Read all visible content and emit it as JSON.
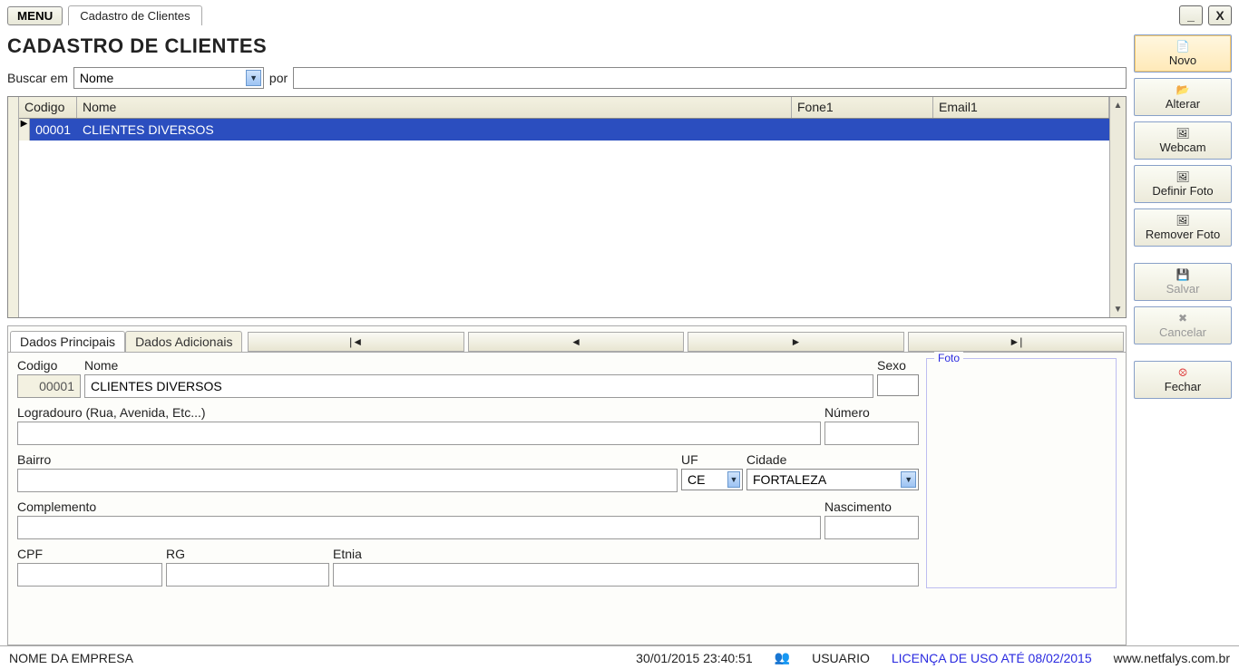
{
  "header": {
    "menu_label": "MENU",
    "tab_label": "Cadastro de Clientes",
    "minimize": "_",
    "close": "X"
  },
  "page_title": "CADASTRO DE CLIENTES",
  "search": {
    "label_buscar": "Buscar em",
    "field_value": "Nome",
    "label_por": "por",
    "term_value": ""
  },
  "grid": {
    "columns": {
      "codigo": "Codigo",
      "nome": "Nome",
      "fone": "Fone1",
      "email": "Email1"
    },
    "rows": [
      {
        "codigo": "00001",
        "nome": "CLIENTES DIVERSOS",
        "fone": "",
        "email": ""
      }
    ]
  },
  "detail": {
    "tabs": {
      "principal": "Dados Principais",
      "adicionais": "Dados Adicionais"
    },
    "nav": {
      "first": "|◄",
      "prev": "◄",
      "next": "►",
      "last": "►|"
    },
    "labels": {
      "codigo": "Codigo",
      "nome": "Nome",
      "sexo": "Sexo",
      "logradouro": "Logradouro (Rua, Avenida, Etc...)",
      "numero": "Número",
      "bairro": "Bairro",
      "uf": "UF",
      "cidade": "Cidade",
      "complemento": "Complemento",
      "nascimento": "Nascimento",
      "cpf": "CPF",
      "rg": "RG",
      "etnia": "Etnia",
      "foto": "Foto"
    },
    "values": {
      "codigo": "00001",
      "nome": "CLIENTES DIVERSOS",
      "sexo": "",
      "logradouro": "",
      "numero": "",
      "bairro": "",
      "uf": "CE",
      "cidade": "FORTALEZA",
      "complemento": "",
      "nascimento": "",
      "cpf": "",
      "rg": "",
      "etnia": ""
    }
  },
  "sidebar": {
    "novo": "Novo",
    "alterar": "Alterar",
    "webcam": "Webcam",
    "definir": "Definir Foto",
    "remover": "Remover Foto",
    "salvar": "Salvar",
    "cancelar": "Cancelar",
    "fechar": "Fechar"
  },
  "status": {
    "company": "NOME DA EMPRESA",
    "datetime": "30/01/2015 23:40:51",
    "user": "USUARIO",
    "license": "LICENÇA DE USO ATÉ 08/02/2015",
    "site": "www.netfalys.com.br"
  }
}
